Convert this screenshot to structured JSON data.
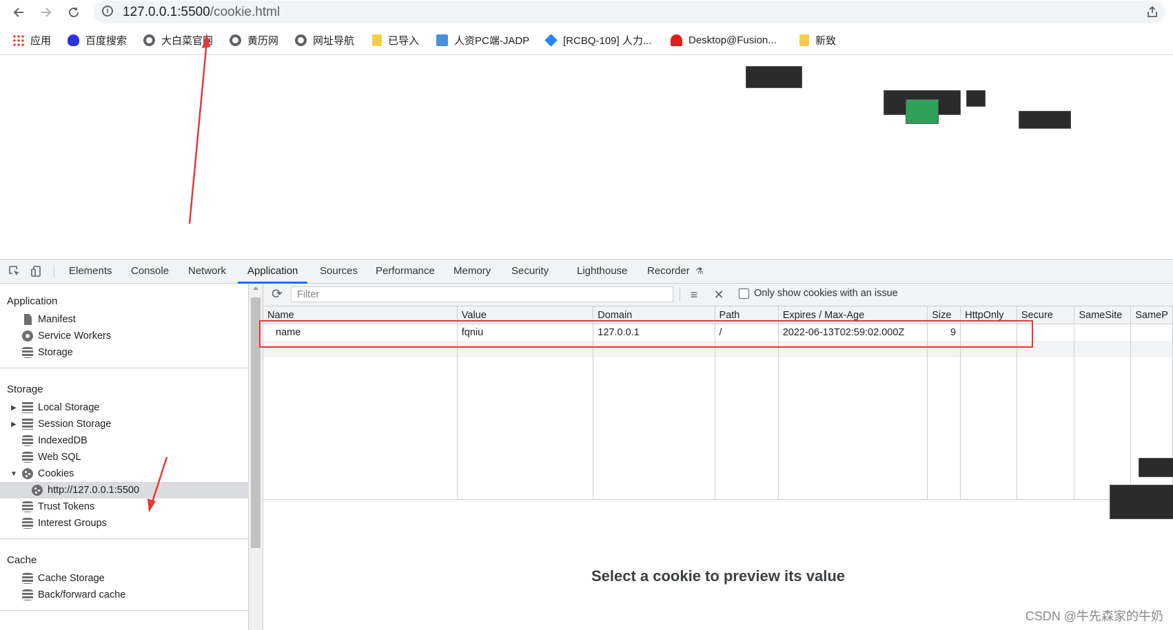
{
  "browser": {
    "url_host": "127.0.0.1:5500",
    "url_path": "/cookie.html"
  },
  "bookmarks": [
    {
      "label": "应用",
      "icon": "apps-grid-icon"
    },
    {
      "label": "百度搜索",
      "icon": "baidu-icon"
    },
    {
      "label": "大白菜官网",
      "icon": "globe-icon"
    },
    {
      "label": "黄历网",
      "icon": "globe-icon"
    },
    {
      "label": "网址导航",
      "icon": "globe-icon"
    },
    {
      "label": "已导入",
      "icon": "folder-icon"
    },
    {
      "label": "人资PC端-JADP",
      "icon": "site-icon"
    },
    {
      "label": "[RCBQ-109] 人力...",
      "icon": "jira-icon"
    },
    {
      "label": "Desktop@Fusion...",
      "icon": "huawei-icon"
    },
    {
      "label": "新致",
      "icon": "folder-icon"
    }
  ],
  "devtools": {
    "tabs": [
      "Elements",
      "Console",
      "Network",
      "Application",
      "Sources",
      "Performance",
      "Memory",
      "Security",
      "Lighthouse",
      "Recorder"
    ],
    "active_tab": "Application"
  },
  "sidebar": {
    "application_header": "Application",
    "application_items": [
      "Manifest",
      "Service Workers",
      "Storage"
    ],
    "storage_header": "Storage",
    "storage_items": [
      "Local Storage",
      "Session Storage",
      "IndexedDB",
      "Web SQL",
      "Cookies"
    ],
    "cookie_origin": "http://127.0.0.1:5500",
    "storage_items_after": [
      "Trust Tokens",
      "Interest Groups"
    ],
    "cache_header": "Cache",
    "cache_items": [
      "Cache Storage",
      "Back/forward cache"
    ]
  },
  "cookies_panel": {
    "filter_placeholder": "Filter",
    "only_issue_label": "Only show cookies with an issue",
    "columns": [
      "Name",
      "Value",
      "Domain",
      "Path",
      "Expires / Max-Age",
      "Size",
      "HttpOnly",
      "Secure",
      "SameSite",
      "SameP"
    ],
    "rows": [
      [
        "name",
        "fqniu",
        "127.0.0.1",
        "/",
        "2022-06-13T02:59:02.000Z",
        "9",
        "",
        "",
        "",
        ""
      ]
    ],
    "preview_message": "Select a cookie to preview its value"
  },
  "watermark": "CSDN @牛先森家的牛奶",
  "colors": {
    "accent": "#1a73e8",
    "highlight_box": "#e53935"
  }
}
